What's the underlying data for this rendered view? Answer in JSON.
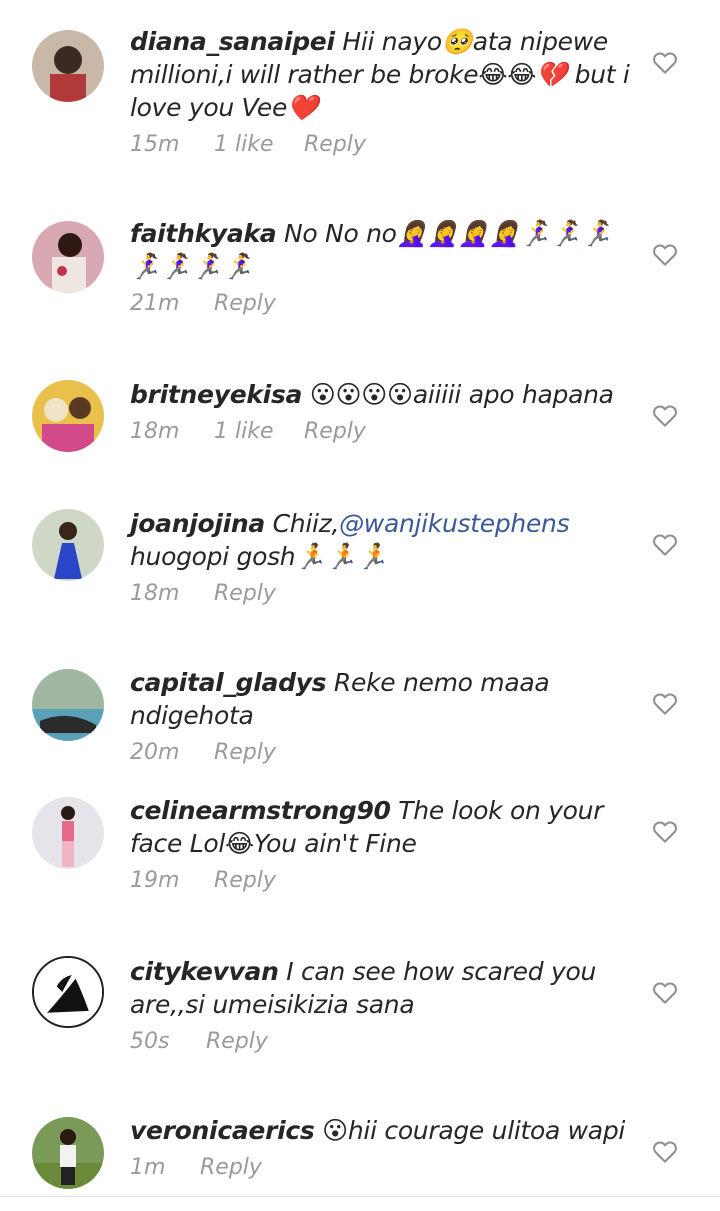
{
  "comments": [
    {
      "user": "diana_sanaipei",
      "text": "Hii nayo🥺ata nipewe millioni,i will rather be broke😂😂💔 but i love you Vee❤️",
      "time": "15m",
      "likes": "1 like",
      "reply": "Reply"
    },
    {
      "user": "faithkyaka",
      "text": "No No no🤦‍♀️🤦‍♀️🤦‍♀️🤦‍♀️🏃‍♀️🏃‍♀️🏃‍♀️🏃‍♀️🏃‍♀️🏃‍♀️🏃‍♀️",
      "time": "21m",
      "likes": "",
      "reply": "Reply"
    },
    {
      "user": "britneyekisa",
      "text": "😮😮😮😮aiiiii apo hapana",
      "time": "18m",
      "likes": "1 like",
      "reply": "Reply"
    },
    {
      "user": "joanjojina",
      "text_before": "Chiiz,",
      "mention": "@wanjikustephens",
      "text_after": " huogopi gosh🏃🏃🏃",
      "time": "18m",
      "likes": "",
      "reply": "Reply"
    },
    {
      "user": "capital_gladys",
      "text": "Reke nemo maaa ndigehota",
      "time": "20m",
      "likes": "",
      "reply": "Reply"
    },
    {
      "user": "celinearmstrong90",
      "text": "The look on your face Lol😂You ain't Fine",
      "time": "19m",
      "likes": "",
      "reply": "Reply"
    },
    {
      "user": "citykevvan",
      "text": "I can see how scared you are,,si umeisikizia sana",
      "time": "50s",
      "likes": "",
      "reply": "Reply"
    },
    {
      "user": "veronicaerics",
      "text": "😮hii courage ulitoa wapi",
      "time": "1m",
      "likes": "",
      "reply": "Reply"
    }
  ],
  "icons": {
    "like": "heart-outline-icon"
  },
  "colors": {
    "meta": "#9a9a9a",
    "mention": "#3b5998",
    "text": "#262626"
  }
}
